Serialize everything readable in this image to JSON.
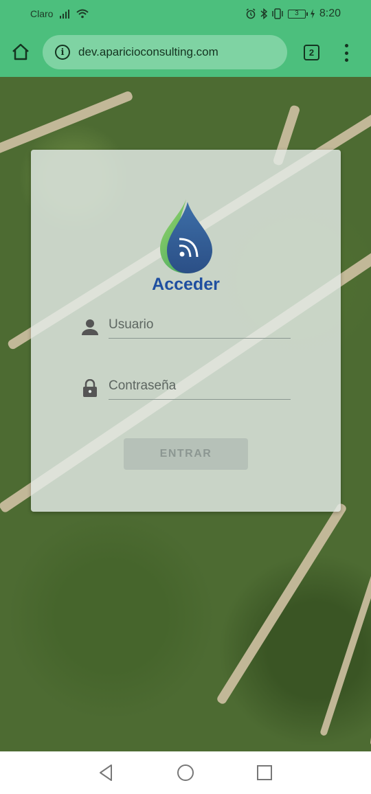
{
  "status_bar": {
    "carrier": "Claro",
    "battery_level": "3",
    "time": "8:20"
  },
  "browser": {
    "url": "dev.aparicioconsulting.com",
    "tab_count": "2"
  },
  "login": {
    "title": "Acceder",
    "username_placeholder": "Usuario",
    "password_placeholder": "Contraseña",
    "submit_label": "ENTRAR"
  },
  "colors": {
    "chrome": "#4cbf7d",
    "title": "#1f4fa0"
  }
}
